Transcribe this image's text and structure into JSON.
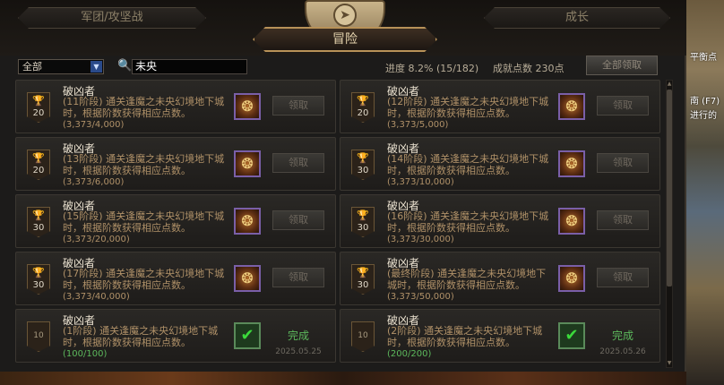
{
  "tabs": {
    "legion": "军团/攻坚战",
    "growth": "成长",
    "adventure": "冒险"
  },
  "filter": {
    "selected": "全部"
  },
  "search": {
    "value": "未央"
  },
  "stats": {
    "progress_label": "进度",
    "progress_value": "8.2% (15/182)",
    "points_label": "成就点数",
    "points_value": "230点"
  },
  "claim_all_label": "全部领取",
  "side": {
    "line1": "平衡点",
    "line2": "南 (F7)",
    "line3": "进行的"
  },
  "achievements": [
    {
      "badge": "20",
      "title": "破凶者",
      "desc": "(11阶段) 通关逢魔之未央幻境地下城时，根据阶数获得相应点数。",
      "progress": "(3,373/4,000)",
      "action": "领取",
      "completed": false
    },
    {
      "badge": "20",
      "title": "破凶者",
      "desc": "(12阶段) 通关逢魔之未央幻境地下城时，根据阶数获得相应点数。",
      "progress": "(3,373/5,000)",
      "action": "领取",
      "completed": false
    },
    {
      "badge": "20",
      "title": "破凶者",
      "desc": "(13阶段) 通关逢魔之未央幻境地下城时，根据阶数获得相应点数。",
      "progress": "(3,373/6,000)",
      "action": "领取",
      "completed": false
    },
    {
      "badge": "30",
      "title": "破凶者",
      "desc": "(14阶段) 通关逢魔之未央幻境地下城时，根据阶数获得相应点数。",
      "progress": "(3,373/10,000)",
      "action": "领取",
      "completed": false
    },
    {
      "badge": "30",
      "title": "破凶者",
      "desc": "(15阶段) 通关逢魔之未央幻境地下城时，根据阶数获得相应点数。",
      "progress": "(3,373/20,000)",
      "action": "领取",
      "completed": false
    },
    {
      "badge": "30",
      "title": "破凶者",
      "desc": "(16阶段) 通关逢魔之未央幻境地下城时，根据阶数获得相应点数。",
      "progress": "(3,373/30,000)",
      "action": "领取",
      "completed": false
    },
    {
      "badge": "30",
      "title": "破凶者",
      "desc": "(17阶段) 通关逢魔之未央幻境地下城时，根据阶数获得相应点数。",
      "progress": "(3,373/40,000)",
      "action": "领取",
      "completed": false
    },
    {
      "badge": "30",
      "title": "破凶者",
      "desc": "(最终阶段) 通关逢魔之未央幻境地下城时，根据阶数获得相应点数。",
      "progress": "(3,373/50,000)",
      "action": "领取",
      "completed": false
    },
    {
      "badge": "10",
      "title": "破凶者",
      "desc": "(1阶段) 通关逢魔之未央幻境地下城时，根据阶数获得相应点数。",
      "progress": "(100/100)",
      "action": "完成",
      "date": "2025.05.25",
      "completed": true
    },
    {
      "badge": "10",
      "title": "破凶者",
      "desc": "(2阶段) 通关逢魔之未央幻境地下城时，根据阶数获得相应点数。",
      "progress": "(200/200)",
      "action": "完成",
      "date": "2025.05.26",
      "completed": true
    }
  ]
}
